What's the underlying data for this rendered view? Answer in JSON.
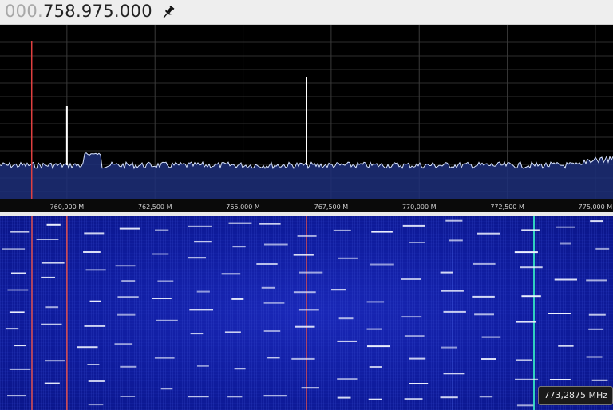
{
  "frequency_display": {
    "dim_prefix": "000.",
    "value": "758.975.000"
  },
  "spectrum": {
    "tick_labels": [
      "760,000 M",
      "762,500 M",
      "765,000 M",
      "767,500 M",
      "770,000 M",
      "772,500 M",
      "775,000 M"
    ],
    "tick_values_mhz": [
      760,
      762.5,
      765,
      767.5,
      770,
      772.5,
      775
    ],
    "view_range_mhz": [
      758.1,
      775.5
    ],
    "cursor_mhz": 759.0,
    "signals_mhz": [
      760.0,
      766.8
    ],
    "trace_color": "#d8e4ff",
    "fill_color": "#1d2f7a",
    "cursor_color": "#e04040"
  },
  "waterfall": {
    "hover_readout": "773,2875 MHz",
    "background_color": "#1224a8",
    "marker_color": "#e05050",
    "highlight_line_color": "#30d0c0"
  },
  "icons": {
    "pin": "pin-icon"
  }
}
